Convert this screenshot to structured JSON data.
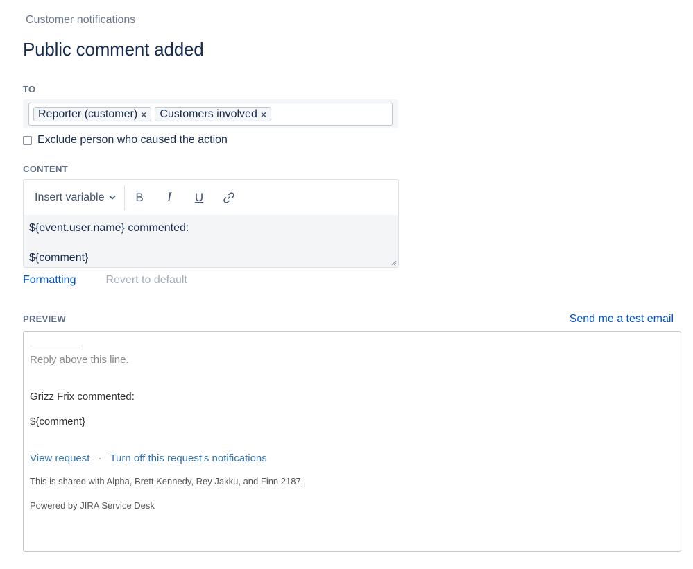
{
  "breadcrumb": "Customer notifications",
  "page_title": "Public comment added",
  "to_section": {
    "label": "TO",
    "recipients": [
      "Reporter (customer)",
      "Customers involved"
    ],
    "remove_glyph": "×"
  },
  "exclude": {
    "label": "Exclude person who caused the action",
    "checked": false
  },
  "content_section": {
    "label": "CONTENT",
    "insert_variable_label": "Insert variable",
    "toolbar": {
      "bold": "B",
      "italic": "I",
      "underline": "U"
    },
    "body_line1": "${event.user.name} commented:",
    "body_line2": "${comment}",
    "formatting_link": "Formatting",
    "revert_link": "Revert to default"
  },
  "preview_section": {
    "label": "PREVIEW",
    "send_test_email": "Send me a test email",
    "reply_above": "Reply above this line.",
    "commented": "Grizz Frix commented:",
    "comment_var": "${comment}",
    "view_request": "View request",
    "separator": "·",
    "turn_off": "Turn off this request's notifications",
    "shared_with": "This is shared with Alpha, Brett Kennedy, Rey Jakku, and Finn 2187.",
    "powered_by": "Powered by JIRA Service Desk"
  },
  "colors": {
    "heading": "#172b4d",
    "link": "#0052cc",
    "muted": "#6b778c",
    "preview_link": "#3572b0"
  }
}
